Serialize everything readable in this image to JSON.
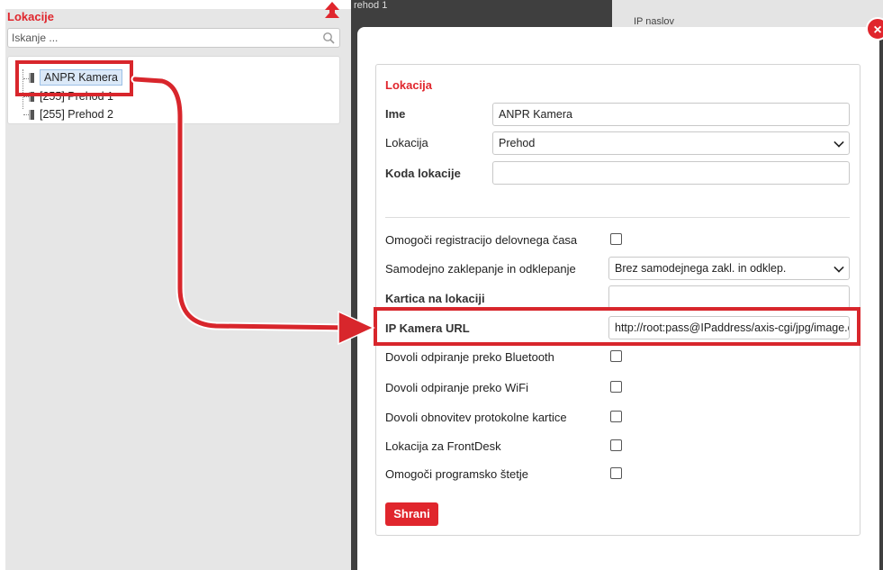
{
  "left_panel": {
    "title": "Lokacije",
    "search_placeholder": "Iskanje ...",
    "tree": [
      {
        "label": "ANPR Kamera"
      },
      {
        "label": "[255] Prehod 1"
      },
      {
        "label": "[255] Prehod 2"
      }
    ]
  },
  "background": {
    "tab_text": "rehod 1",
    "column_header": "IP naslov"
  },
  "dialog": {
    "close_label": "×",
    "section_title": "Lokacija",
    "fields": {
      "name_label": "Ime",
      "name_value": "ANPR Kamera",
      "location_label": "Lokacija",
      "location_value": "Prehod",
      "code_label": "Koda lokacije",
      "code_value": "",
      "worktime_label": "Omogoči registracijo delovnega časa",
      "autolock_label": "Samodejno zaklepanje in odklepanje",
      "autolock_value": "Brez samodejnega zakl. in odklep.",
      "card_label": "Kartica na lokaciji",
      "card_value": "",
      "ipcam_label": "IP Kamera URL",
      "ipcam_value": "http://root:pass@IPaddress/axis-cgi/jpg/image.cgi",
      "bluetooth_label": "Dovoli odpiranje preko Bluetooth",
      "wifi_label": "Dovoli odpiranje preko WiFi",
      "protocol_label": "Dovoli obnovitev protokolne kartice",
      "frontdesk_label": "Lokacija za FrontDesk",
      "counting_label": "Omogoči programsko štetje"
    },
    "save_label": "Shrani"
  },
  "colors": {
    "accent": "#e0262d",
    "annotation": "#d8262c"
  }
}
